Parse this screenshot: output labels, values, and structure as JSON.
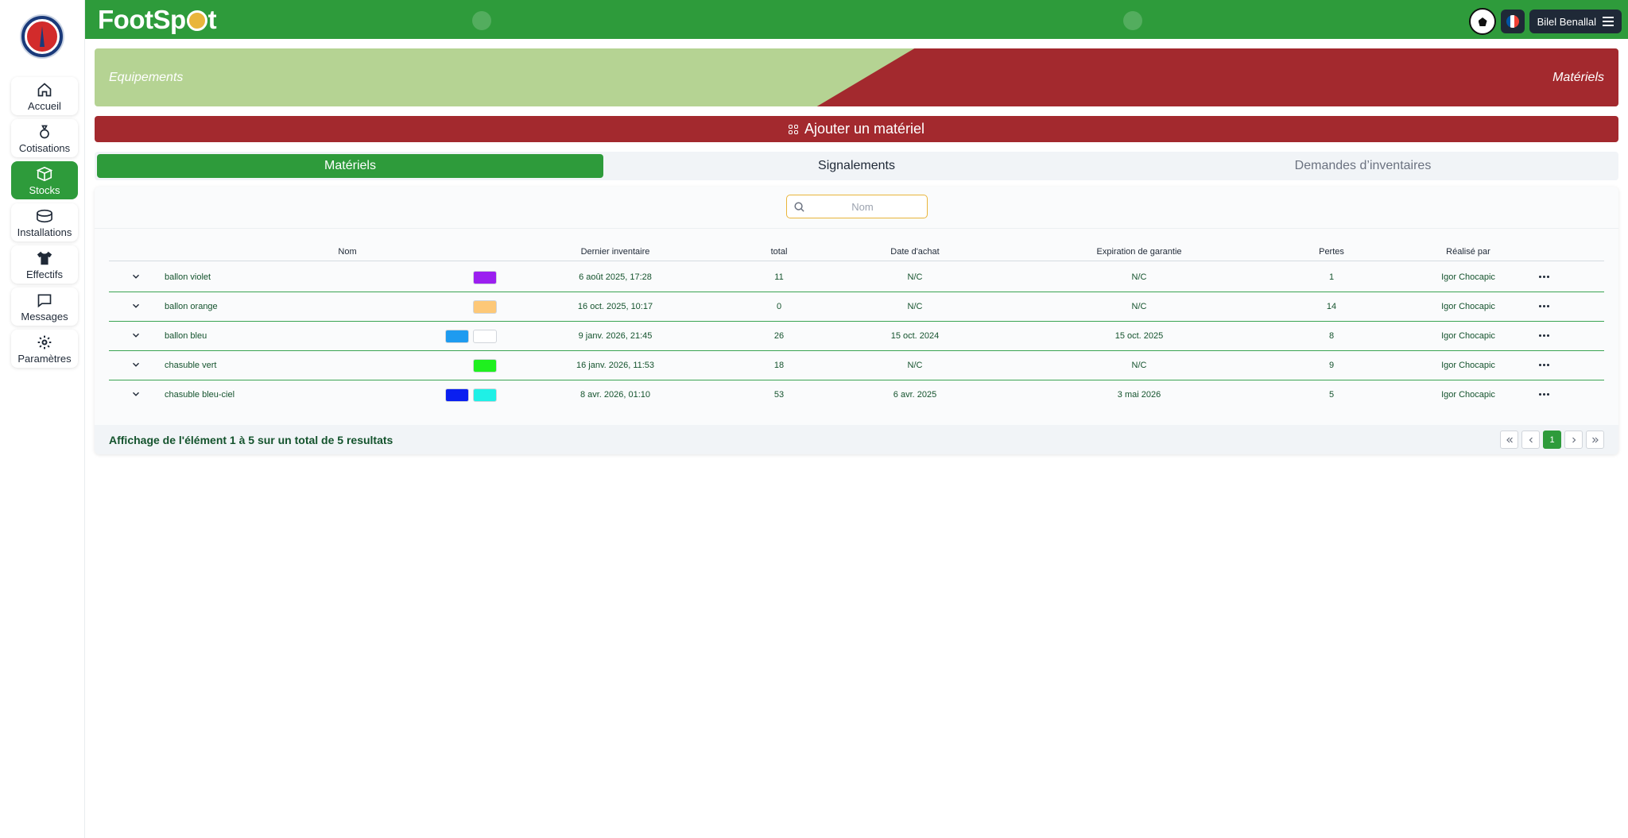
{
  "brand": {
    "name_part1": "FootSp",
    "name_part2": "t"
  },
  "user": {
    "name": "Bilel Benallal"
  },
  "sidebar": {
    "items": [
      {
        "label": "Accueil",
        "icon": "home-icon"
      },
      {
        "label": "Cotisations",
        "icon": "money-bag-icon"
      },
      {
        "label": "Stocks",
        "icon": "box-icon",
        "active": true
      },
      {
        "label": "Installations",
        "icon": "stadium-icon"
      },
      {
        "label": "Effectifs",
        "icon": "jersey-icon"
      },
      {
        "label": "Messages",
        "icon": "chat-icon"
      },
      {
        "label": "Paramètres",
        "icon": "gear-icon"
      }
    ]
  },
  "banner": {
    "left": "Equipements",
    "right": "Matériels"
  },
  "add_button": {
    "label": "Ajouter un matériel"
  },
  "tabs": [
    {
      "label": "Matériels",
      "active": true
    },
    {
      "label": "Signalements"
    },
    {
      "label": "Demandes d’inventaires"
    }
  ],
  "search": {
    "placeholder": "Nom"
  },
  "table": {
    "headers": {
      "name": "Nom",
      "last_inventory": "Dernier inventaire",
      "total": "total",
      "purchase_date": "Date d'achat",
      "warranty": "Expiration de garantie",
      "losses": "Pertes",
      "done_by": "Réalisé par"
    },
    "rows": [
      {
        "name": "ballon violet",
        "colors": [
          "#9b1ff0"
        ],
        "last_inventory": "6 août 2025, 17:28",
        "total": "11",
        "purchase_date": "N/C",
        "warranty": "N/C",
        "losses": "1",
        "done_by": "Igor Chocapic"
      },
      {
        "name": "ballon orange",
        "colors": [
          "#fdc878"
        ],
        "last_inventory": "16 oct. 2025, 10:17",
        "total": "0",
        "purchase_date": "N/C",
        "warranty": "N/C",
        "losses": "14",
        "done_by": "Igor Chocapic"
      },
      {
        "name": "ballon bleu",
        "colors": [
          "#1e9bf0",
          "#ffffff"
        ],
        "last_inventory": "9 janv. 2026, 21:45",
        "total": "26",
        "purchase_date": "15 oct. 2024",
        "warranty": "15 oct. 2025",
        "losses": "8",
        "done_by": "Igor Chocapic"
      },
      {
        "name": "chasuble vert",
        "colors": [
          "#1ff01f"
        ],
        "last_inventory": "16 janv. 2026, 11:53",
        "total": "18",
        "purchase_date": "N/C",
        "warranty": "N/C",
        "losses": "9",
        "done_by": "Igor Chocapic"
      },
      {
        "name": "chasuble bleu-ciel",
        "colors": [
          "#0a1ff0",
          "#1ff0e6"
        ],
        "last_inventory": "8 avr. 2026, 01:10",
        "total": "53",
        "purchase_date": "6 avr. 2025",
        "warranty": "3 mai 2026",
        "losses": "5",
        "done_by": "Igor Chocapic"
      }
    ]
  },
  "footer": {
    "summary": "Affichage de l'élément 1 à 5 sur un total de 5 resultats"
  },
  "pagination": {
    "current": "1"
  },
  "colors": {
    "primary": "#2e9b3b",
    "danger": "#a3292e",
    "banner_light": "#b5d393",
    "accent": "#e9b53b"
  }
}
